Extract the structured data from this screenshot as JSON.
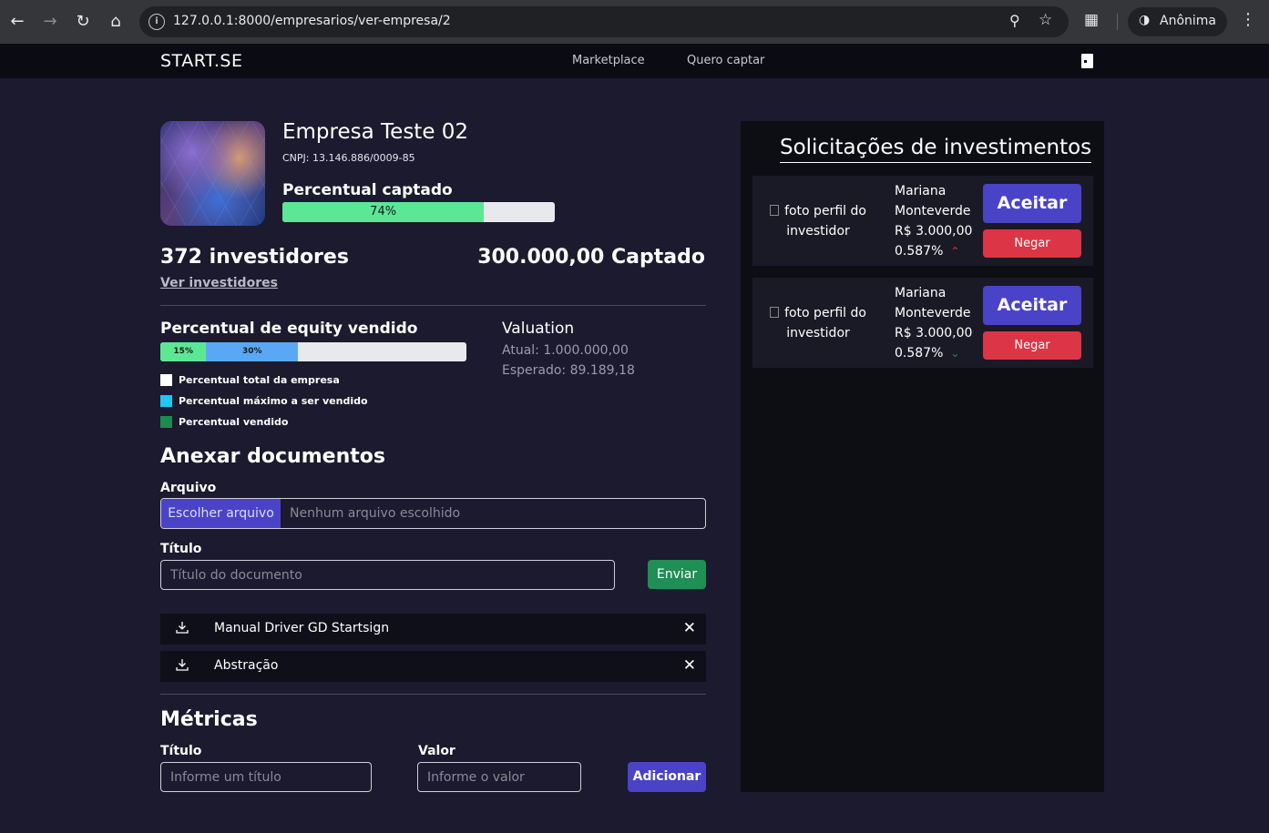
{
  "browser": {
    "url": "127.0.0.1:8000/empresarios/ver-empresa/2",
    "profile_label": "Anônima"
  },
  "navbar": {
    "brand": "START.SE",
    "links": [
      "Marketplace",
      "Quero captar"
    ]
  },
  "company": {
    "name": "Empresa Teste 02",
    "cnpj": "CNPJ:  13.146.886/0009-85",
    "captado_label": "Percentual captado",
    "captado_percent": 74,
    "captado_text": "74%",
    "investidores": "372 investidores",
    "ver_investidores": "Ver investidores",
    "captado_total": "300.000,00 Captado"
  },
  "equity": {
    "label": "Percentual de equity vendido",
    "segments": [
      {
        "text": "15%",
        "value": 15,
        "color": "#5ce795"
      },
      {
        "text": "30%",
        "value": 30,
        "color": "#5aa8f5"
      }
    ],
    "legend": [
      {
        "label": "Percentual total da empresa",
        "color": "#ffffff"
      },
      {
        "label": "Percentual máximo a ser vendido",
        "color": "#1ec8f0"
      },
      {
        "label": "Percentual vendido",
        "color": "#1d8a4f"
      }
    ]
  },
  "valuation": {
    "title": "Valuation",
    "atual": "Atual: 1.000.000,00",
    "esperado": "Esperado:  89.189,18"
  },
  "documents": {
    "title": "Anexar documentos",
    "arquivo_label": "Arquivo",
    "file_button": "Escolher arquivo",
    "file_status": "Nenhum arquivo escolhido",
    "titulo_label": "Título",
    "titulo_placeholder": "Título do documento",
    "submit": "Enviar",
    "items": [
      "Manual Driver GD Startsign",
      "Abstração"
    ]
  },
  "metricas": {
    "title": "Métricas",
    "titulo_label": "Título",
    "titulo_placeholder": "Informe um título",
    "valor_label": "Valor",
    "valor_placeholder": "Informe o valor",
    "submit": "Adicionar"
  },
  "solicitacoes": {
    "title": "Solicitações de investimentos",
    "items": [
      {
        "photo_alt": "foto perfil do investidor",
        "name_line1": "Mariana",
        "name_line2": "Monteverde",
        "amount": "R$ 3.000,00",
        "percent": "0.587%",
        "trend": "up",
        "trend_color": "#dc3545",
        "accept": "Aceitar",
        "reject": "Negar"
      },
      {
        "photo_alt": "foto perfil do investidor",
        "name_line1": "Mariana",
        "name_line2": "Monteverde",
        "amount": "R$ 3.000,00",
        "percent": "0.587%",
        "trend": "down",
        "trend_color": "#1f8f55",
        "accept": "Aceitar",
        "reject": "Negar"
      }
    ]
  }
}
